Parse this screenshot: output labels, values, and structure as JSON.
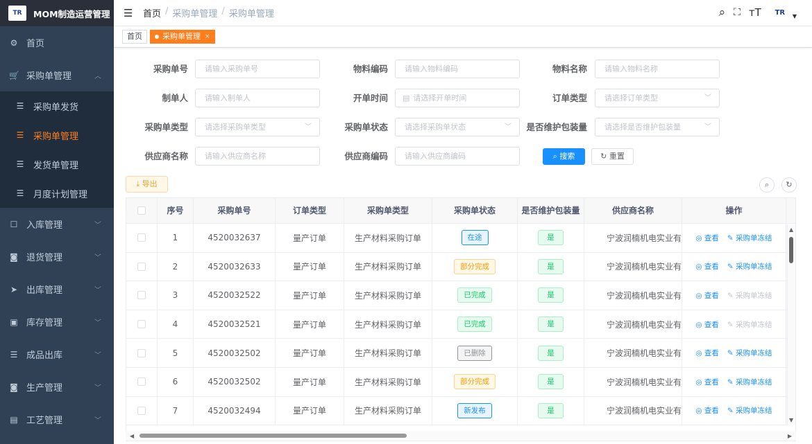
{
  "app": {
    "logo_text": "TR",
    "title": "MOM制造运营管理"
  },
  "sidebar": {
    "items": [
      {
        "icon": "dashboard-icon",
        "glyph": "⚙",
        "label": "首页",
        "expandable": false
      },
      {
        "icon": "cart-icon",
        "glyph": "🛒",
        "label": "采购单管理",
        "expandable": true,
        "expanded": true,
        "children": [
          {
            "icon": "list-icon",
            "label": "采购单发货",
            "active": false
          },
          {
            "icon": "list-icon",
            "label": "采购单管理",
            "active": true
          },
          {
            "icon": "list-icon",
            "label": "发货单管理",
            "active": false
          },
          {
            "icon": "list-icon",
            "label": "月度计划管理",
            "active": false
          }
        ]
      },
      {
        "icon": "inbound-icon",
        "glyph": "☐",
        "label": "入库管理",
        "expandable": true
      },
      {
        "icon": "return-icon",
        "glyph": "◙",
        "label": "退货管理",
        "expandable": true
      },
      {
        "icon": "outbound-icon",
        "glyph": "➤",
        "label": "出库管理",
        "expandable": true
      },
      {
        "icon": "inventory-icon",
        "glyph": "▣",
        "label": "库存管理",
        "expandable": true
      },
      {
        "icon": "list-icon",
        "glyph": "☰",
        "label": "成品出库",
        "expandable": true
      },
      {
        "icon": "production-icon",
        "glyph": "◙",
        "label": "生产管理",
        "expandable": true
      },
      {
        "icon": "process-icon",
        "glyph": "▤",
        "label": "工艺管理",
        "expandable": true
      }
    ]
  },
  "header": {
    "breadcrumb": [
      "首页",
      "采购单管理",
      "采购单管理"
    ],
    "avatar_text": "TR"
  },
  "tags": [
    {
      "label": "首页",
      "active": false
    },
    {
      "label": "采购单管理",
      "active": true
    }
  ],
  "search_form": {
    "po_no": {
      "label": "采购单号",
      "placeholder": "请输入采购单号"
    },
    "material_code": {
      "label": "物料编码",
      "placeholder": "请输入物料编码"
    },
    "material_name": {
      "label": "物料名称",
      "placeholder": "请输入物料名称"
    },
    "creator": {
      "label": "制单人",
      "placeholder": "请输入制单人"
    },
    "open_time": {
      "label": "开单时间",
      "placeholder": "请选择开单时间"
    },
    "order_type": {
      "label": "订单类型",
      "placeholder": "请选择订单类型"
    },
    "po_type": {
      "label": "采购单类型",
      "placeholder": "请选择采购单类型"
    },
    "po_status": {
      "label": "采购单状态",
      "placeholder": "请选择采购单状态"
    },
    "maintain_pack": {
      "label": "是否维护包装量",
      "placeholder": "请选择是否维护包装量"
    },
    "supplier_name": {
      "label": "供应商名称",
      "placeholder": "请输入供应商名称"
    },
    "supplier_code": {
      "label": "供应商编码",
      "placeholder": "请输入供应商编码"
    },
    "search_label": "搜索",
    "reset_label": "重置"
  },
  "toolbar": {
    "export_label": "导出"
  },
  "table": {
    "columns": [
      "序号",
      "采购单号",
      "订单类型",
      "采购单类型",
      "采购单状态",
      "是否维护包装量",
      "供应商名称",
      "操作"
    ],
    "view_label": "查看",
    "freeze_label": "采购单冻结",
    "rows": [
      {
        "idx": "1",
        "po": "4520032637",
        "order_type": "量产订单",
        "po_type": "生产材料采购订单",
        "status": "在途",
        "status_style": "blue",
        "maintain": "是",
        "supplier": "宁波润楠机电实业有限公司",
        "freeze_enabled": true
      },
      {
        "idx": "2",
        "po": "4520032633",
        "order_type": "量产订单",
        "po_type": "生产材料采购订单",
        "status": "部分完成",
        "status_style": "orange",
        "maintain": "是",
        "supplier": "宁波润楠机电实业有限公司",
        "freeze_enabled": true
      },
      {
        "idx": "3",
        "po": "4520032522",
        "order_type": "量产订单",
        "po_type": "生产材料采购订单",
        "status": "已完成",
        "status_style": "green",
        "maintain": "是",
        "supplier": "宁波润楠机电实业有限公司",
        "freeze_enabled": false
      },
      {
        "idx": "4",
        "po": "4520032521",
        "order_type": "量产订单",
        "po_type": "生产材料采购订单",
        "status": "已完成",
        "status_style": "green",
        "maintain": "是",
        "supplier": "宁波润楠机电实业有限公司",
        "freeze_enabled": false
      },
      {
        "idx": "5",
        "po": "4520032502",
        "order_type": "量产订单",
        "po_type": "生产材料采购订单",
        "status": "已删除",
        "status_style": "gray",
        "maintain": "是",
        "supplier": "宁波润楠机电实业有限公司",
        "freeze_enabled": true
      },
      {
        "idx": "6",
        "po": "4520032502",
        "order_type": "量产订单",
        "po_type": "生产材料采购订单",
        "status": "部分完成",
        "status_style": "orange",
        "maintain": "是",
        "supplier": "宁波润楠机电实业有限公司",
        "freeze_enabled": true
      },
      {
        "idx": "7",
        "po": "4520032494",
        "order_type": "量产订单",
        "po_type": "生产材料采购订单",
        "status": "新发布",
        "status_style": "blue",
        "maintain": "是",
        "supplier": "宁波润楠机电实业有限公司",
        "freeze_enabled": true
      }
    ]
  }
}
